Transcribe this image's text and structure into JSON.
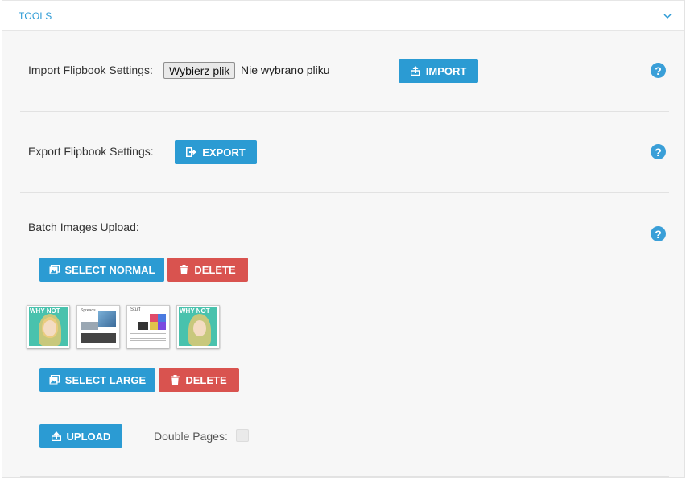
{
  "panel": {
    "title": "TOOLS",
    "collapse_icon": "chevron-down-icon"
  },
  "import": {
    "label": "Import Flipbook Settings:",
    "file_button": "Wybierz plik",
    "file_status": "Nie wybrano pliku",
    "button_label": "IMPORT",
    "button_icon": "upload-icon"
  },
  "export": {
    "label": "Export Flipbook Settings:",
    "button_label": "EXPORT",
    "button_icon": "sign-out-icon"
  },
  "batch": {
    "label": "Batch Images Upload:",
    "select_normal_label": "SELECT NORMAL",
    "delete_label": "DELETE",
    "select_large_label": "SELECT LARGE",
    "delete_large_label": "DELETE",
    "upload_label": "UPLOAD",
    "double_pages_label": "Double Pages:",
    "double_pages_checked": false,
    "thumbnails": [
      {
        "name": "thumb-cover-1",
        "caption": "WHY NOT"
      },
      {
        "name": "thumb-spread-1",
        "caption": "Spreads"
      },
      {
        "name": "thumb-spread-2",
        "caption": "Stuff"
      },
      {
        "name": "thumb-cover-2",
        "caption": "WHY NOT"
      }
    ]
  },
  "help_icon": "question-mark-icon",
  "colors": {
    "accent": "#2b9bd3",
    "danger": "#d9534f",
    "title": "#2e9bd6"
  }
}
